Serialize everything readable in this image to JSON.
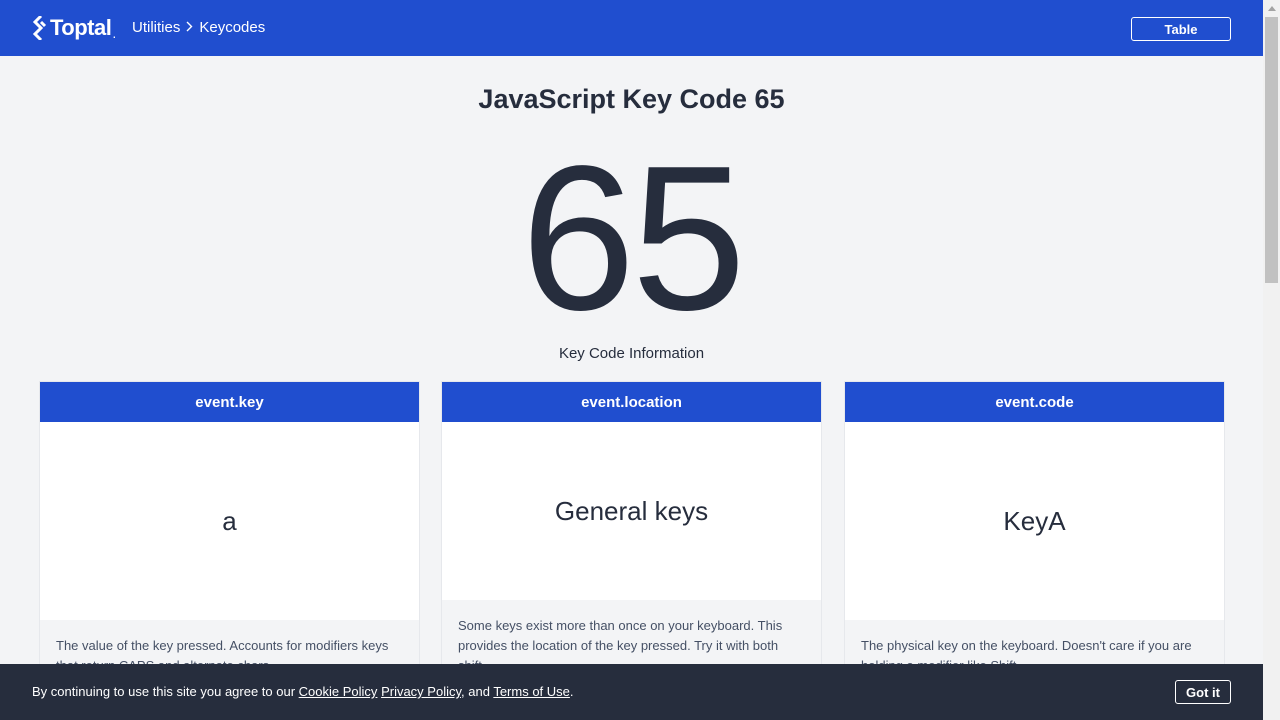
{
  "header": {
    "logo_text": "Toptal",
    "logo_dot": ".",
    "breadcrumb": [
      "Utilities",
      "Keycodes"
    ],
    "table_button": "Table"
  },
  "main": {
    "title": "JavaScript Key Code 65",
    "key_code": "65",
    "info_label": "Key Code Information"
  },
  "cards": [
    {
      "header": "event.key",
      "value": "a",
      "description": "The value of the key pressed. Accounts for modifiers keys that return CAPS and alternate chars."
    },
    {
      "header": "event.location",
      "value": "General keys",
      "description": "Some keys exist more than once on your keyboard. This provides the location of the key pressed. Try it with both shift."
    },
    {
      "header": "event.code",
      "value": "KeyA",
      "description": "The physical key on the keyboard. Doesn't care if you are holding a modifier like Shift."
    }
  ],
  "cookie_banner": {
    "prefix": "By continuing to use this site you agree to our",
    "cookie_policy": "Cookie Policy",
    "privacy_policy": "Privacy Policy",
    "and_text": ", and",
    "terms": "Terms of Use",
    "period": ".",
    "got_it": "Got it"
  },
  "colors": {
    "brand_blue": "#204ecf",
    "dark": "#262d3d",
    "background": "#f3f4f6"
  }
}
